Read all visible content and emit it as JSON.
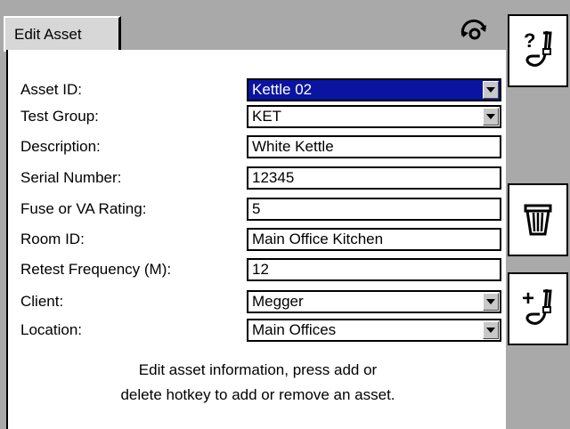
{
  "tab": {
    "title": "Edit Asset"
  },
  "icons": {
    "tab_icon": "rotate-arrows-icon",
    "help": "help-probe-icon",
    "delete": "trash-bin-icon",
    "add": "add-probe-icon"
  },
  "form": {
    "fields": [
      {
        "label": "Asset ID:",
        "value": "Kettle 02",
        "dropdown": true,
        "selected": true
      },
      {
        "label": "Test Group:",
        "value": "KET",
        "dropdown": true,
        "selected": false
      },
      {
        "label": "Description:",
        "value": "White Kettle",
        "dropdown": false
      },
      {
        "label": "Serial Number:",
        "value": "12345",
        "dropdown": false
      },
      {
        "label": "Fuse or VA Rating:",
        "value": "5",
        "dropdown": false
      },
      {
        "label": "Room ID:",
        "value": "Main Office Kitchen",
        "dropdown": false
      },
      {
        "label": "Retest Frequency (M):",
        "value": "12",
        "dropdown": false
      },
      {
        "label": "Client:",
        "value": "Megger",
        "dropdown": true
      },
      {
        "label": "Location:",
        "value": "Main Offices",
        "dropdown": true
      }
    ]
  },
  "hint": {
    "line1": "Edit asset information, press add or",
    "line2": "delete hotkey to add or remove an asset."
  },
  "colors": {
    "selected_bg": "#0a14a0",
    "chrome": "#a9a9a9",
    "panel": "#ffffff"
  }
}
